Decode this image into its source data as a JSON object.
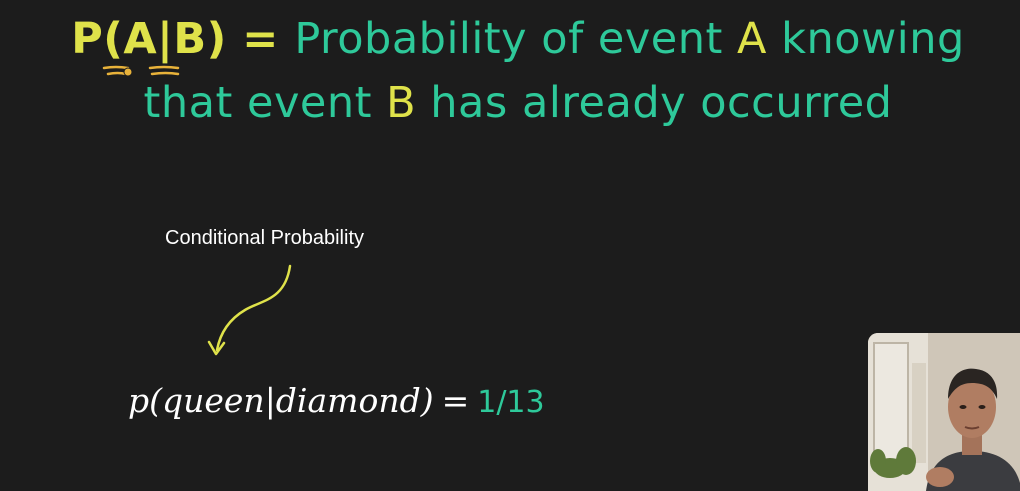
{
  "headline": {
    "notation_p": "P(",
    "notation_a": "A",
    "notation_bar": "|",
    "notation_b": "B",
    "notation_close": ")",
    "equals": " = ",
    "line1_text": "Probability of event ",
    "line1_a": "A",
    "line1_tail": " knowing",
    "line2_text": "that event ",
    "line2_b": "B",
    "line2_tail": " has already occurred"
  },
  "caption": "Conditional Probability",
  "formula": {
    "expression": "p(queen|diamond)",
    "equals": "=",
    "result": "1/13"
  },
  "colors": {
    "background": "#1c1c1c",
    "teal": "#2ec99a",
    "yellow": "#dfe24a",
    "annotation": "#e8b23a"
  },
  "webcam": {
    "label": "presenter-video"
  }
}
